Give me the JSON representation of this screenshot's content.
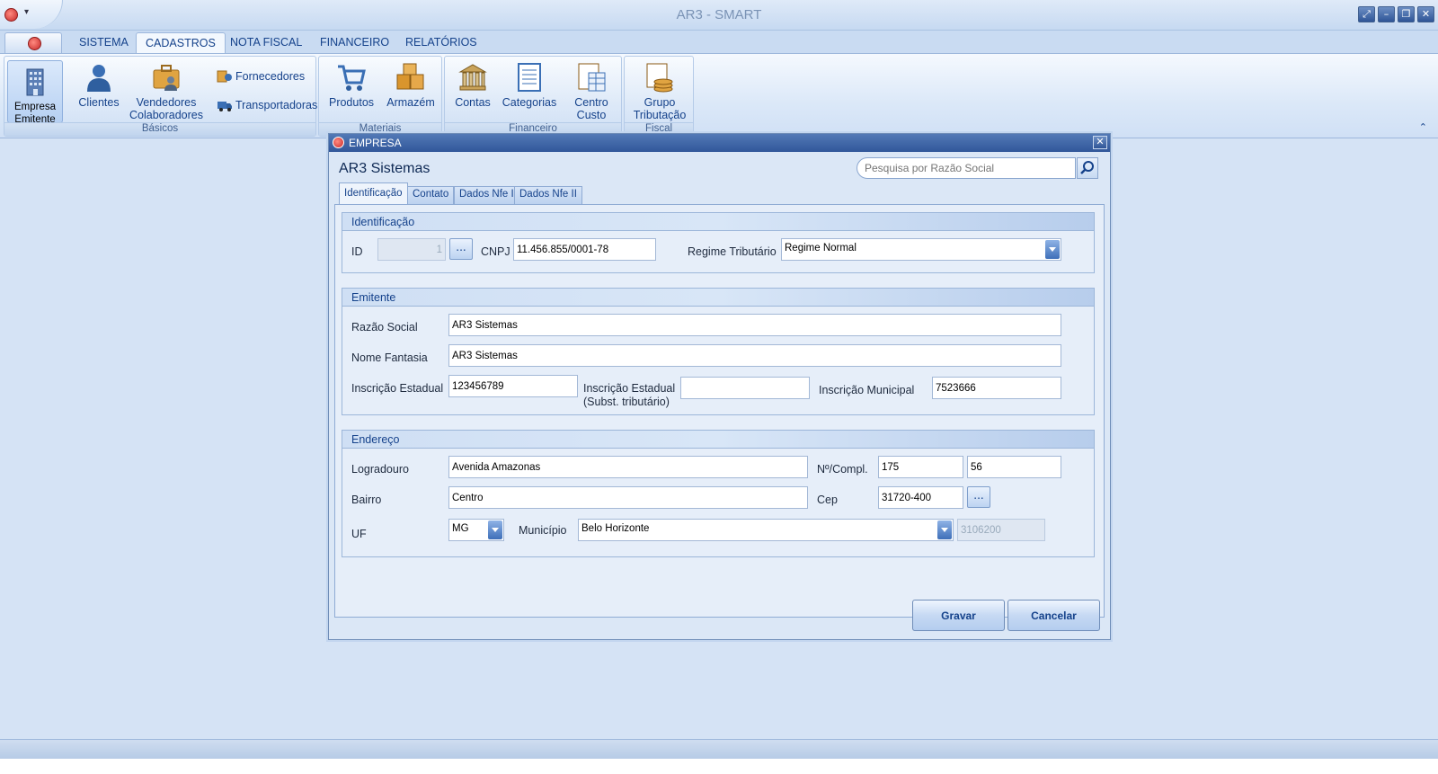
{
  "window": {
    "title": "AR3 - SMART",
    "controls": {
      "restore": "⤢",
      "minimize": "–",
      "maximize": "❐",
      "close": "✕"
    }
  },
  "ribbon": {
    "tabs": [
      "SISTEMA",
      "CADASTROS",
      "NOTA FISCAL",
      "FINANCEIRO",
      "RELATÓRIOS"
    ],
    "active_tab": "CADASTROS",
    "groups": {
      "basicos": {
        "label": "Básicos",
        "empresa_line1": "Empresa",
        "empresa_line2": "Emitente",
        "clientes": "Clientes",
        "vendedores_line1": "Vendedores",
        "vendedores_line2": "Colaboradores",
        "fornecedores": "Fornecedores",
        "transportadoras": "Transportadoras"
      },
      "materiais": {
        "label": "Materiais",
        "produtos": "Produtos",
        "armazem": "Armazém"
      },
      "financeiro": {
        "label": "Financeiro",
        "contas": "Contas",
        "categorias": "Categorias",
        "centro_line1": "Centro",
        "centro_line2": "Custo"
      },
      "fiscal": {
        "label": "Fiscal",
        "grupo_line1": "Grupo",
        "grupo_line2": "Tributação"
      }
    },
    "collapse_glyph": "⌃"
  },
  "dialog": {
    "title": "EMPRESA",
    "close": "✕",
    "heading": "AR3 Sistemas",
    "search_placeholder": "Pesquisa por Razão Social",
    "tabs": [
      "Identificação",
      "Contato",
      "Dados Nfe I",
      "Dados Nfe II"
    ],
    "active_tab": "Identificação",
    "identificacao": {
      "header": "Identificação",
      "id_label": "ID",
      "id_value": "1",
      "ellipsis": "...",
      "cnpj_label": "CNPJ",
      "cnpj_value": "11.456.855/0001-78",
      "regime_label": "Regime Tributário",
      "regime_value": "Regime Normal"
    },
    "emitente": {
      "header": "Emitente",
      "razao_label": "Razão Social",
      "razao_value": "AR3 Sistemas",
      "fantasia_label": "Nome Fantasia",
      "fantasia_value": "AR3 Sistemas",
      "ie_label": "Inscrição Estadual",
      "ie_value": "123456789",
      "ie_st_label_line1": "Inscrição Estadual",
      "ie_st_label_line2": "(Subst. tributário)",
      "ie_st_value": "",
      "im_label": "Inscrição Municipal",
      "im_value": "7523666"
    },
    "endereco": {
      "header": "Endereço",
      "logradouro_label": "Logradouro",
      "logradouro_value": "Avenida Amazonas",
      "numero_label": "Nº/Compl.",
      "numero_value": "175",
      "compl_value": "56",
      "bairro_label": "Bairro",
      "bairro_value": "Centro",
      "cep_label": "Cep",
      "cep_value": "31720-400",
      "ellipsis": "...",
      "uf_label": "UF",
      "uf_value": "MG",
      "municipio_label": "Município",
      "municipio_value": "Belo Horizonte",
      "ibge_value": "3106200"
    },
    "buttons": {
      "save": "Gravar",
      "cancel": "Cancelar"
    }
  }
}
